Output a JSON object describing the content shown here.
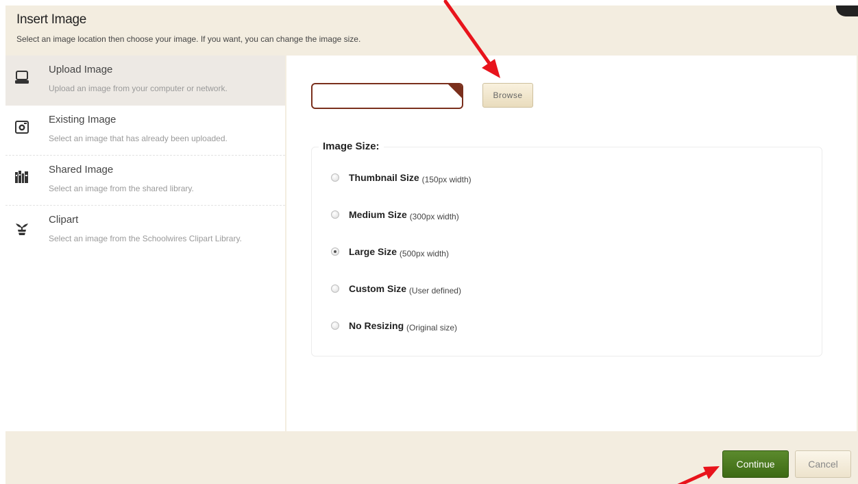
{
  "dialog": {
    "title": "Insert Image",
    "subtitle": "Select an image location then choose your image. If you want, you can change the image size."
  },
  "sidebar": {
    "items": [
      {
        "label": "Upload Image",
        "description": "Upload an image from your computer or network.",
        "icon": "laptop-icon",
        "active": true
      },
      {
        "label": "Existing Image",
        "description": "Select an image that has already been uploaded.",
        "icon": "camera-icon",
        "active": false
      },
      {
        "label": "Shared Image",
        "description": "Select an image from the shared library.",
        "icon": "library-icon",
        "active": false
      },
      {
        "label": "Clipart",
        "description": "Select an image from the Schoolwires Clipart Library.",
        "icon": "plant-icon",
        "active": false
      }
    ]
  },
  "upload": {
    "file_value": "",
    "browse_label": "Browse"
  },
  "image_size": {
    "legend": "Image Size:",
    "selected": "Large Size",
    "options": [
      {
        "label": "Thumbnail Size",
        "hint": "(150px width)",
        "checked": false
      },
      {
        "label": "Medium Size",
        "hint": "(300px width)",
        "checked": false
      },
      {
        "label": "Large Size",
        "hint": "(500px width)",
        "checked": true
      },
      {
        "label": "Custom Size",
        "hint": "(User defined)",
        "checked": false
      },
      {
        "label": "No Resizing",
        "hint": "(Original size)",
        "checked": false
      }
    ]
  },
  "footer": {
    "continue_label": "Continue",
    "cancel_label": "Cancel"
  },
  "colors": {
    "dialog_bg": "#f3ede0",
    "accent_red": "#e8141c",
    "continue_green": "#4a7a1f",
    "file_border": "#7a2f1c"
  }
}
